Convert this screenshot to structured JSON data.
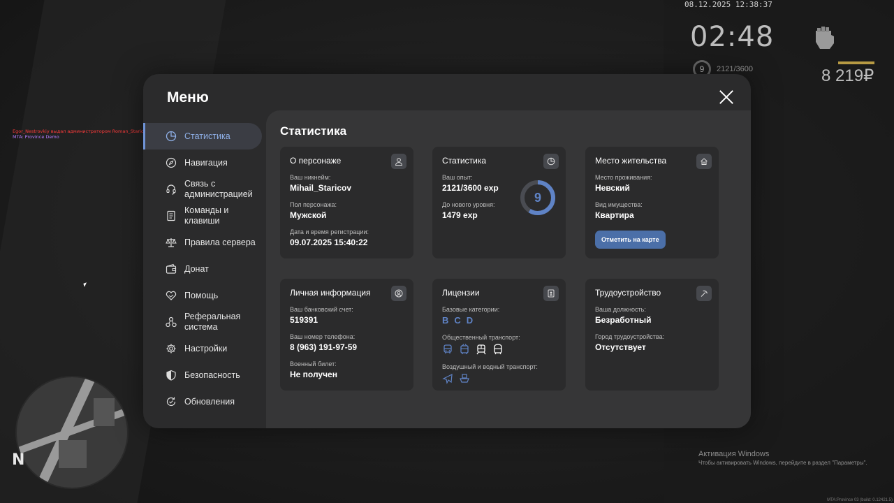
{
  "hud": {
    "datetime": "08.12.2025 12:38:37",
    "time": "02:48",
    "level": "9",
    "exp": "2121/3600",
    "money": "8 219₽"
  },
  "chat": {
    "line1": "Egor_Nestrovkiy выдал администратором Roman_Staricov (Ar ...)",
    "line2": "MTA: Province Demo"
  },
  "windows": {
    "activation_title": "Активация Windows",
    "activation_text": "Чтобы активировать Windows, перейдите в раздел \"Параметры\"."
  },
  "build": "MTA:Province 03 (build: 0.12421.5)",
  "minimap": {
    "north": "N"
  },
  "menu": {
    "title": "Меню",
    "nav": [
      {
        "label": "Статистика",
        "icon": "pie-chart-icon",
        "active": true
      },
      {
        "label": "Навигация",
        "icon": "compass-icon"
      },
      {
        "label": "Связь с администрацией",
        "icon": "headset-icon"
      },
      {
        "label": "Команды и клавиши",
        "icon": "document-icon"
      },
      {
        "label": "Правила сервера",
        "icon": "scales-icon"
      },
      {
        "label": "Донат",
        "icon": "wallet-icon"
      },
      {
        "label": "Помощь",
        "icon": "heart-handshake-icon"
      },
      {
        "label": "Реферальная система",
        "icon": "referral-icon"
      },
      {
        "label": "Настройки",
        "icon": "gear-icon"
      },
      {
        "label": "Безопасность",
        "icon": "shield-icon"
      },
      {
        "label": "Обновления",
        "icon": "update-icon"
      }
    ],
    "content_title": "Статистика"
  },
  "cards": {
    "character": {
      "title": "О персонаже",
      "nickname_label": "Ваш никнейм:",
      "nickname": "Mihail_Staricov",
      "gender_label": "Пол персонажа:",
      "gender": "Мужской",
      "reg_label": "Дата и время регистрации:",
      "reg": "09.07.2025 15:40:22"
    },
    "stats": {
      "title": "Статистика",
      "exp_label": "Ваш опыт:",
      "exp": "2121/3600 exp",
      "next_label": "До нового уровня:",
      "next": "1479 exp",
      "level": "9",
      "level_progress": 0.589
    },
    "residence": {
      "title": "Место жительства",
      "place_label": "Место проживания:",
      "place": "Невский",
      "type_label": "Вид имущества:",
      "type": "Квартира",
      "button": "Отметить на карте"
    },
    "personal": {
      "title": "Личная информация",
      "bank_label": "Ваш банковский счет:",
      "bank": "519391",
      "phone_label": "Ваш номер телефона:",
      "phone": "8 (963) 191-97-59",
      "military_label": "Военный билет:",
      "military": "Не получен"
    },
    "licenses": {
      "title": "Лицензии",
      "base_label": "Базовые категории:",
      "base": [
        "B",
        "C",
        "D"
      ],
      "public_label": "Общественный транспорт:",
      "air_label": "Воздушный и водный транспорт:"
    },
    "job": {
      "title": "Трудоустройство",
      "position_label": "Ваша должность:",
      "position": "Безработный",
      "city_label": "Город трудоустройства:",
      "city": "Отсутствует"
    }
  },
  "colors": {
    "accent": "#5f83c6",
    "button": "#4b6fa8",
    "panel": "#2b2b2c",
    "content": "#363637"
  }
}
